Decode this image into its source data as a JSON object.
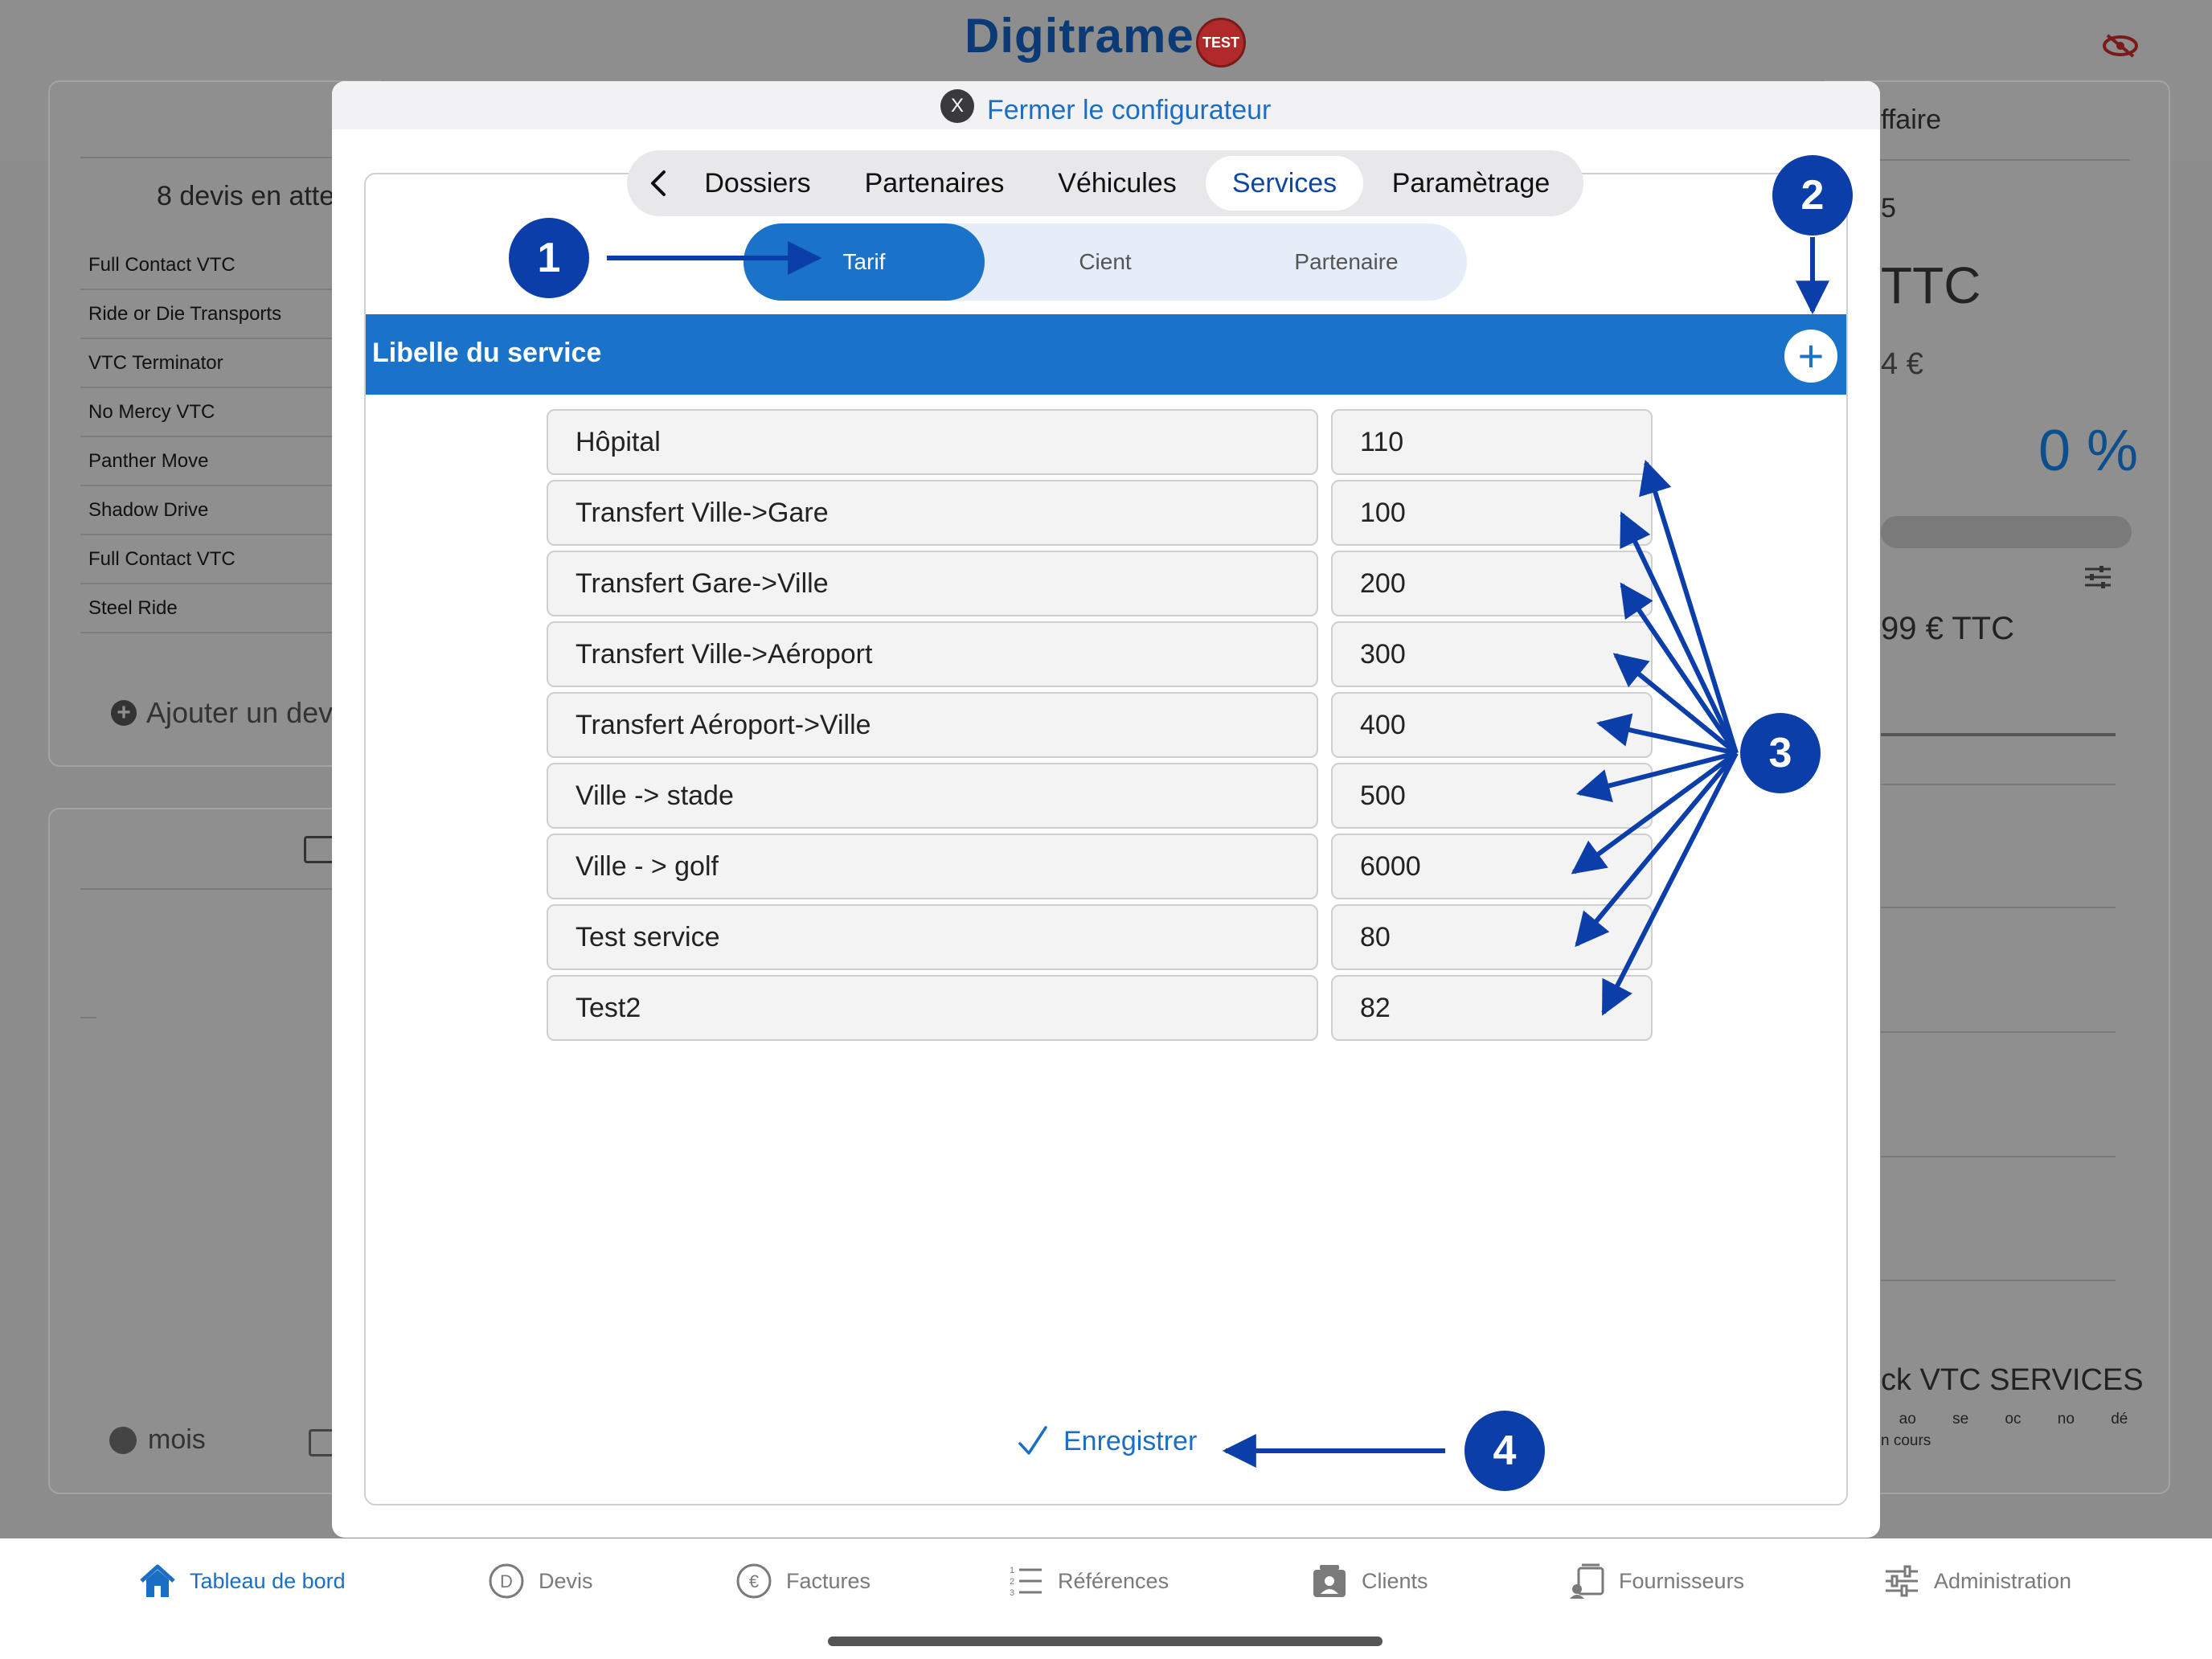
{
  "app": {
    "logo_text": "Digitrame",
    "badge": "TEST"
  },
  "background": {
    "left_card": {
      "title": "8 devis en atte",
      "items": [
        "Full Contact VTC",
        "Ride or Die Transports",
        "VTC Terminator",
        "No Mercy VTC",
        "Panther Move",
        "Shadow Drive",
        "Full Contact VTC",
        "Steel Ride"
      ],
      "add_label": "Ajouter un dev",
      "period_label": "mois"
    },
    "right_card": {
      "title_fragment": "ffaire",
      "line2": "5",
      "line3": "TTC",
      "line4": "4 €",
      "percent": "0 %",
      "line6": "99 €  TTC",
      "line7": "ck VTC SERVICES",
      "months": [
        "ao",
        "se",
        "oc",
        "no",
        "dé"
      ],
      "encours": "n cours"
    }
  },
  "modal": {
    "close_label": "Fermer le configurateur",
    "close_icon_text": "X",
    "main_tabs": [
      "Dossiers",
      "Partenaires",
      "Véhicules",
      "Services",
      "Paramètrage"
    ],
    "active_main_tab": "Services",
    "sub_tabs": [
      "Tarif",
      "Cient",
      "Partenaire"
    ],
    "active_sub_tab": "Tarif",
    "header_label": "Libelle du service",
    "services": [
      {
        "name": "Hôpital",
        "price": "110"
      },
      {
        "name": "Transfert Ville->Gare",
        "price": "100"
      },
      {
        "name": "Transfert Gare->Ville",
        "price": "200"
      },
      {
        "name": "Transfert Ville->Aéroport",
        "price": "300"
      },
      {
        "name": "Transfert Aéroport->Ville",
        "price": "400"
      },
      {
        "name": "Ville -> stade",
        "price": "500"
      },
      {
        "name": "Ville - > golf",
        "price": "6000"
      },
      {
        "name": "Test service",
        "price": "80"
      },
      {
        "name": "Test2",
        "price": "82"
      }
    ],
    "save_label": "Enregistrer"
  },
  "callouts": [
    "1",
    "2",
    "3",
    "4"
  ],
  "tabbar": [
    {
      "label": "Tableau de bord",
      "icon": "home-icon",
      "active": true
    },
    {
      "label": "Devis",
      "icon": "devis-icon",
      "active": false
    },
    {
      "label": "Factures",
      "icon": "euro-icon",
      "active": false
    },
    {
      "label": "Références",
      "icon": "list-icon",
      "active": false
    },
    {
      "label": "Clients",
      "icon": "clients-icon",
      "active": false
    },
    {
      "label": "Fournisseurs",
      "icon": "suppliers-icon",
      "active": false
    },
    {
      "label": "Administration",
      "icon": "sliders-icon",
      "active": false
    }
  ],
  "colors": {
    "accent": "#1a73c8",
    "callout": "#0b3ea8",
    "link": "#1a6fc4"
  }
}
